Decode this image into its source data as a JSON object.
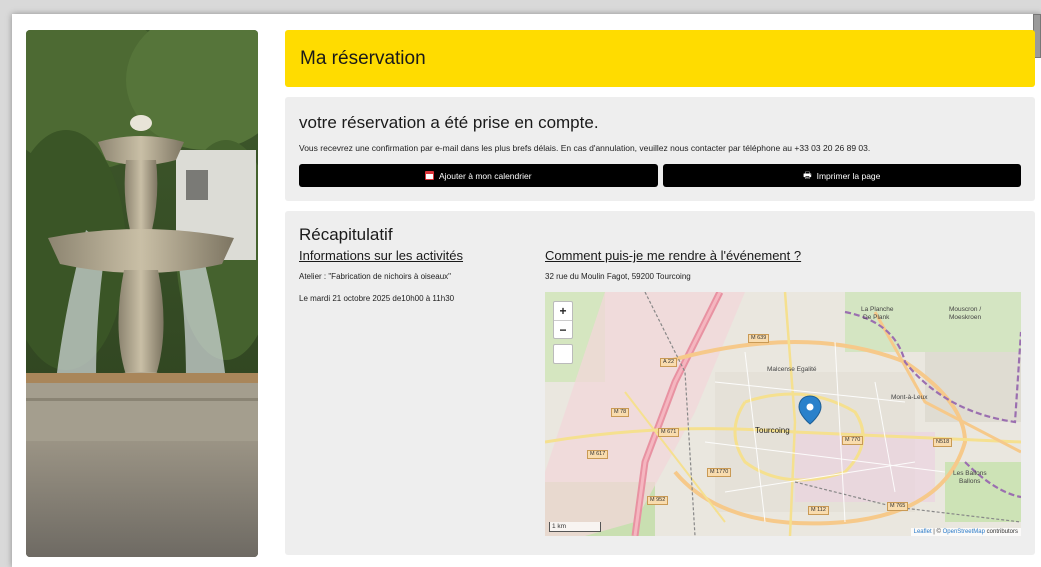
{
  "banner": {
    "title": "Ma réservation"
  },
  "confirmation": {
    "heading": "votre réservation a été prise en compte.",
    "message": "Vous recevrez une confirmation par e-mail dans les plus brefs délais. En cas d'annulation, veuillez nous contacter par téléphone au +33 03 20 26 89 03.",
    "calendar_button": "Ajouter à mon calendrier",
    "print_button": "Imprimer la page"
  },
  "recap": {
    "heading": "Récapitulatif",
    "activities_heading": "Informations sur les activités",
    "activity_name": "Atelier : \"Fabrication de nichoirs à oiseaux\"",
    "activity_date": "Le mardi 21 octobre 2025 de10h00 à 11h30",
    "directions_heading": "Comment puis-je me rendre à l'événement ?",
    "address": "32 rue du Moulin Fagot, 59200 Tourcoing"
  },
  "map": {
    "zoom_in": "+",
    "zoom_out": "−",
    "scale": "1 km",
    "attribution_leaflet": "Leaflet",
    "attribution_sep": " | © ",
    "attribution_osm": "OpenStreetMap",
    "attribution_rest": " contributors",
    "places": {
      "tourcoing": "Tourcoing",
      "marcq": "Malcense Egalité",
      "planche": "La Planche",
      "plank": "De Plank",
      "mouscron": "Mouscron /",
      "moeskroen": "Moeskroen",
      "montaleux": "Mont-à-Leux",
      "ballons": "Les Ballons",
      "ballons2": "Ballons"
    },
    "roads": {
      "r1": "M 639",
      "r2": "A 22",
      "r3": "M 78",
      "r4": "M 671",
      "r5": "M 617",
      "r6": "M 1770",
      "r7": "M 952",
      "r8": "M 112",
      "r9": "M 765",
      "r10": "M 770",
      "r11": "N518"
    }
  },
  "colors": {
    "banner": "#ffdc00",
    "button": "#000000",
    "marker": "#2a81cb"
  }
}
